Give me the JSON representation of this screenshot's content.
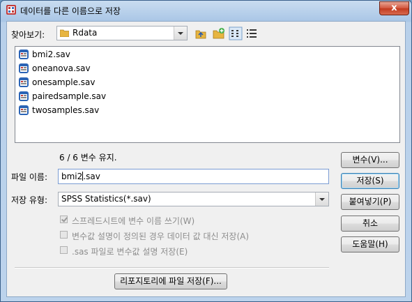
{
  "window": {
    "title": "데이터를 다른 이름으로 저장",
    "close_label": "x"
  },
  "lookin": {
    "label": "찾아보기:",
    "folder": "Rdata"
  },
  "toolbar": {
    "icons": [
      "up-folder-icon",
      "new-folder-icon",
      "list-view-icon",
      "details-view-icon"
    ]
  },
  "files": [
    {
      "name": "bmi2.sav"
    },
    {
      "name": "oneanova.sav"
    },
    {
      "name": "onesample.sav"
    },
    {
      "name": "pairedsample.sav"
    },
    {
      "name": "twosamples.sav"
    }
  ],
  "status": {
    "variables_kept": "6 / 6 변수 유지."
  },
  "filename": {
    "label": "파일 이름:",
    "value_before_caret": "bmi2",
    "value_after_caret": ".sav"
  },
  "filetype": {
    "label": "저장 유형:",
    "value": "SPSS Statistics(*.sav)"
  },
  "options": [
    {
      "label": "스프레드시트에 변수 이름 쓰기(W)",
      "checked": true,
      "enabled": false
    },
    {
      "label": "변수값 설명이 정의된 경우 데이터 값 대신 저장(A)",
      "checked": false,
      "enabled": false
    },
    {
      "label": ".sas 파일로 변수값 설명 저장(E)",
      "checked": false,
      "enabled": false
    }
  ],
  "buttons": {
    "variables": "변수(V)...",
    "save": "저장(S)",
    "paste": "붙여넣기(P)",
    "cancel": "취소",
    "help": "도움말(H)",
    "repository": "리포지토리에 파일 저장(F)..."
  },
  "colors": {
    "accent": "#3c7fb1",
    "close": "#c23a1f",
    "title_bar": "#a9c6e6"
  }
}
